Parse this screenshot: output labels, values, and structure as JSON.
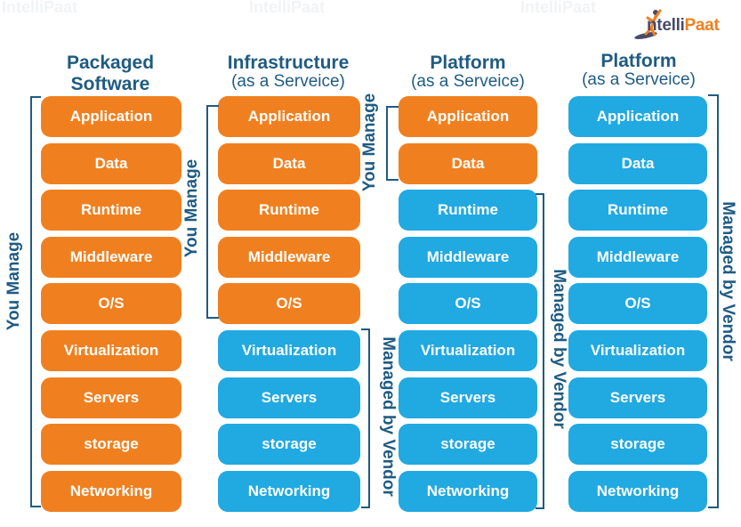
{
  "brand": {
    "logo_prefix": "ntelli",
    "logo_suffix": "Paat",
    "logo_initial": "I",
    "primary_color": "#1f5b82",
    "customer_managed_color": "#f0801f",
    "vendor_managed_color": "#21a9e1"
  },
  "watermark": "IntelliPaat",
  "layers": [
    "Application",
    "Data",
    "Runtime",
    "Middleware",
    "O/S",
    "Virtualization",
    "Servers",
    "storage",
    "Networking"
  ],
  "columns": [
    {
      "title": "Packaged",
      "title_line2": "Software",
      "subtitle": "",
      "you_manage_count": 9,
      "labels": {
        "you_manage": "You Manage",
        "vendor": ""
      }
    },
    {
      "title": "Infrastructure",
      "title_line2": "",
      "subtitle": "(as a Serveice)",
      "you_manage_count": 5,
      "labels": {
        "you_manage": "You Manage",
        "vendor": "Managed by Vendor"
      }
    },
    {
      "title": "Platform",
      "title_line2": "",
      "subtitle": "(as a Serveice)",
      "you_manage_count": 2,
      "labels": {
        "you_manage": "You Manage",
        "vendor": "Managed by Vendor"
      }
    },
    {
      "title": "Platform",
      "title_line2": "",
      "subtitle": "(as a Serveice)",
      "you_manage_count": 0,
      "labels": {
        "you_manage": "",
        "vendor": "Managed by Vendor"
      }
    }
  ]
}
